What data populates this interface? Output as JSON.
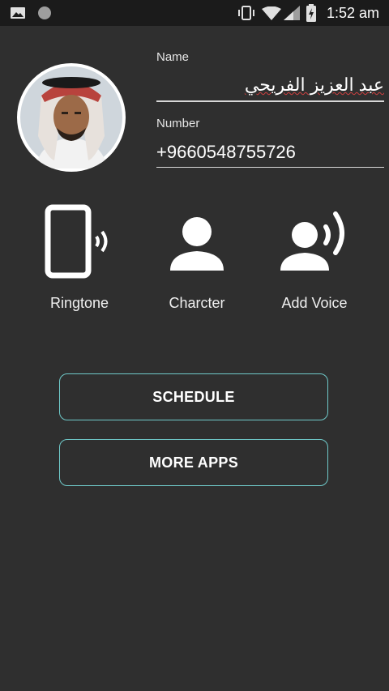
{
  "status_bar": {
    "time": "1:52 am",
    "icons": [
      "image-icon",
      "circle-icon",
      "vibrate-icon",
      "wifi-icon",
      "signal-icon",
      "battery-charging-icon"
    ]
  },
  "contact": {
    "name_label": "Name",
    "name_value": "عبد العزيز الفريحي",
    "number_label": "Number",
    "number_value": "+9660548755726"
  },
  "options": [
    {
      "label": "Ringtone",
      "icon": "phone-ringtone-icon"
    },
    {
      "label": "Charcter",
      "icon": "person-icon"
    },
    {
      "label": "Add Voice",
      "icon": "person-voice-icon"
    }
  ],
  "buttons": {
    "schedule": "SCHEDULE",
    "more_apps": "MORE APPS"
  },
  "colors": {
    "background": "#2f2f2f",
    "status_bar": "#1b1b1b",
    "button_border": "#6fc9c9"
  }
}
